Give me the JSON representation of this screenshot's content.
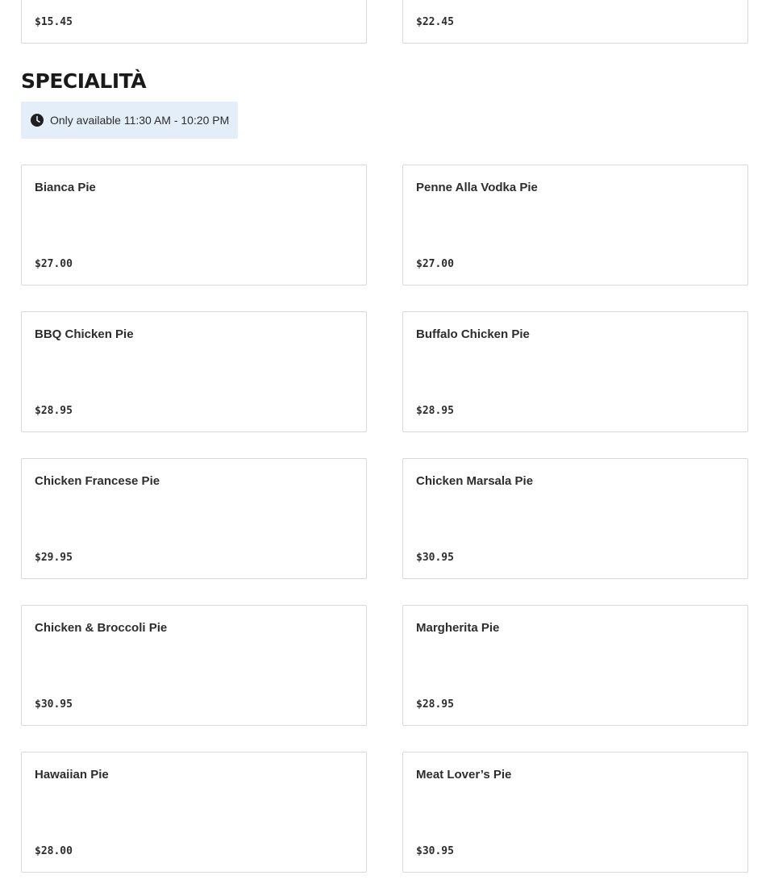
{
  "previous_section": {
    "items": [
      {
        "price": "$15.45"
      },
      {
        "price": "$22.45"
      }
    ]
  },
  "section": {
    "title": "SPECIALITÀ",
    "availability": "Only available 11:30 AM - 10:20 PM",
    "icon": "clock-icon",
    "items": [
      {
        "name": "Bianca Pie",
        "price": "$27.00"
      },
      {
        "name": "Penne Alla Vodka Pie",
        "price": "$27.00"
      },
      {
        "name": "BBQ Chicken Pie",
        "price": "$28.95"
      },
      {
        "name": "Buffalo Chicken Pie",
        "price": "$28.95"
      },
      {
        "name": "Chicken Francese Pie",
        "price": "$29.95"
      },
      {
        "name": "Chicken Marsala Pie",
        "price": "$30.95"
      },
      {
        "name": "Chicken & Broccoli Pie",
        "price": "$30.95"
      },
      {
        "name": "Margherita Pie",
        "price": "$28.95"
      },
      {
        "name": "Hawaiian Pie",
        "price": "$28.00"
      },
      {
        "name": "Meat Lover’s Pie",
        "price": "$30.95"
      }
    ]
  },
  "colors": {
    "availability_bg": "#e3eef9",
    "card_border": "#d9d9d9",
    "text": "#2d2d2d"
  }
}
